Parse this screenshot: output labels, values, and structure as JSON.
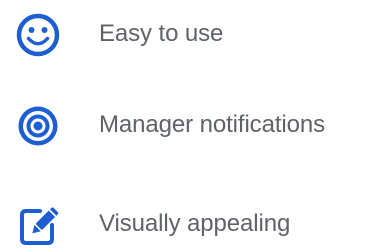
{
  "colors": {
    "accent": "#1d5fd1",
    "text": "#5f6368",
    "background": "#ffffff"
  },
  "features": [
    {
      "icon": "smiley-face-icon",
      "label": "Easy to use"
    },
    {
      "icon": "target-icon",
      "label": "Manager notifications"
    },
    {
      "icon": "edit-pencil-icon",
      "label": "Visually appealing"
    }
  ]
}
